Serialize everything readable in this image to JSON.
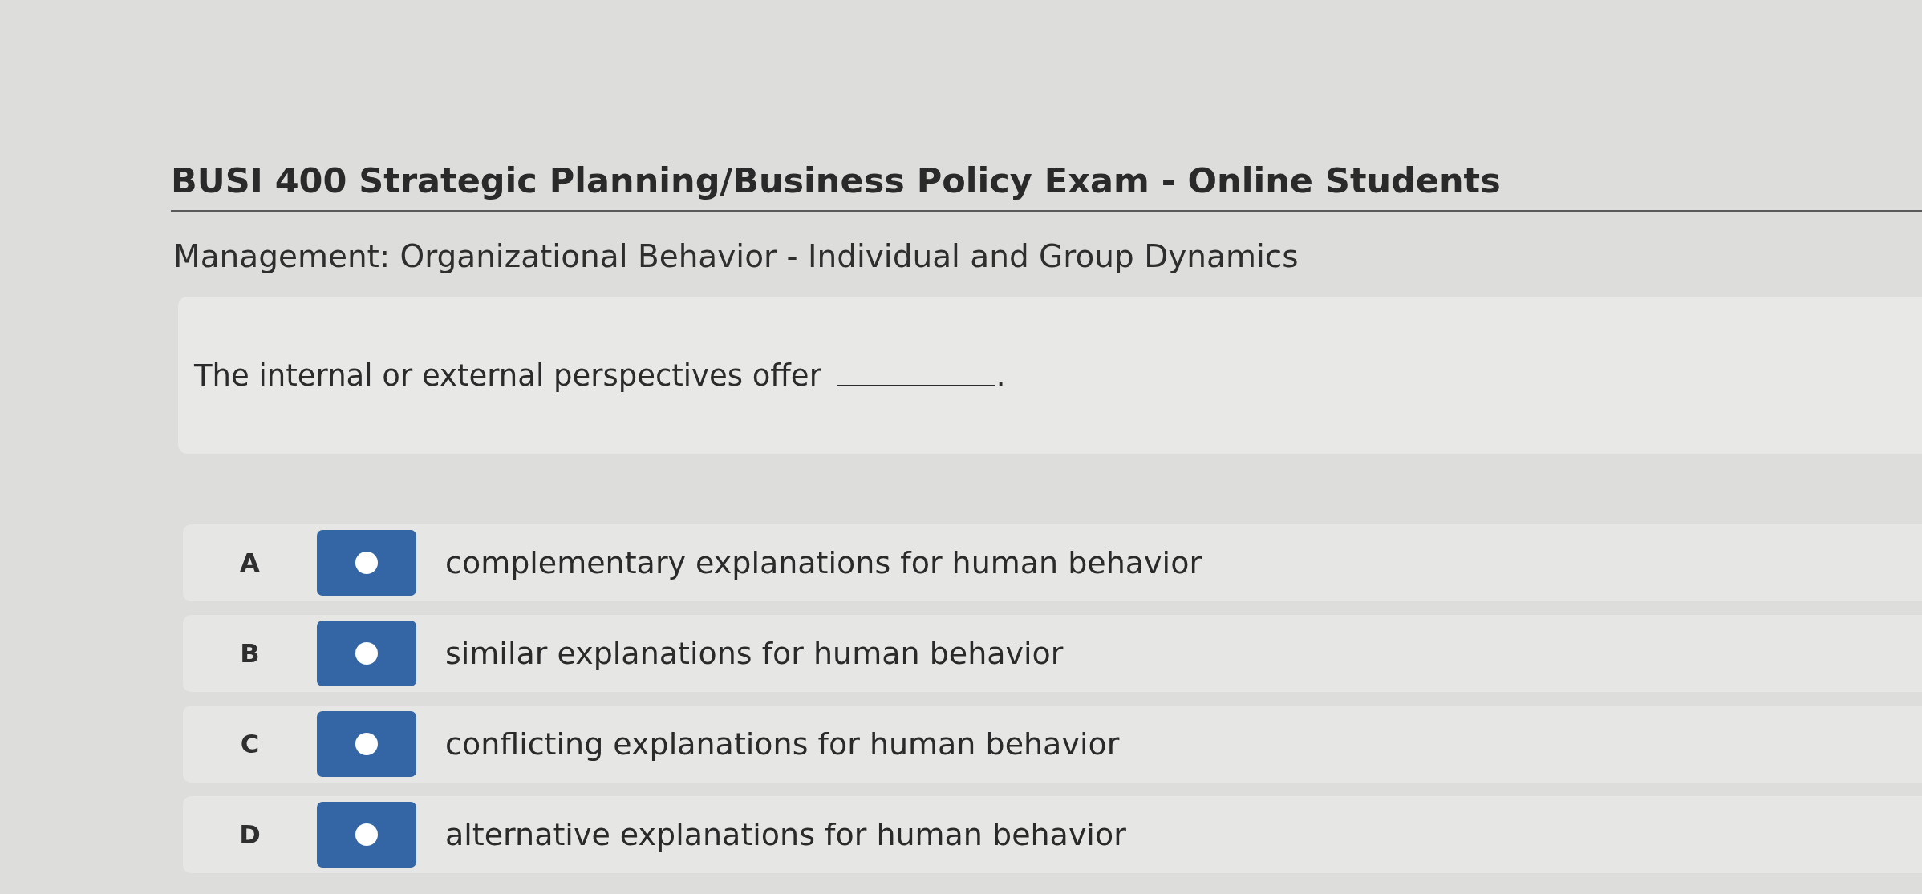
{
  "exam": {
    "title": "BUSI 400 Strategic Planning/Business Policy Exam - Online Students"
  },
  "topic": "Management: Organizational Behavior - Individual and Group Dynamics",
  "question": {
    "text_before": "The internal or external perspectives offer",
    "text_after": "."
  },
  "options": [
    {
      "letter": "A",
      "text": "complementary explanations for human behavior",
      "selected": false
    },
    {
      "letter": "B",
      "text": "similar explanations for human behavior",
      "selected": false
    },
    {
      "letter": "C",
      "text": "conflicting explanations for human behavior",
      "selected": false
    },
    {
      "letter": "D",
      "text": "alternative explanations for human behavior",
      "selected": false
    }
  ]
}
